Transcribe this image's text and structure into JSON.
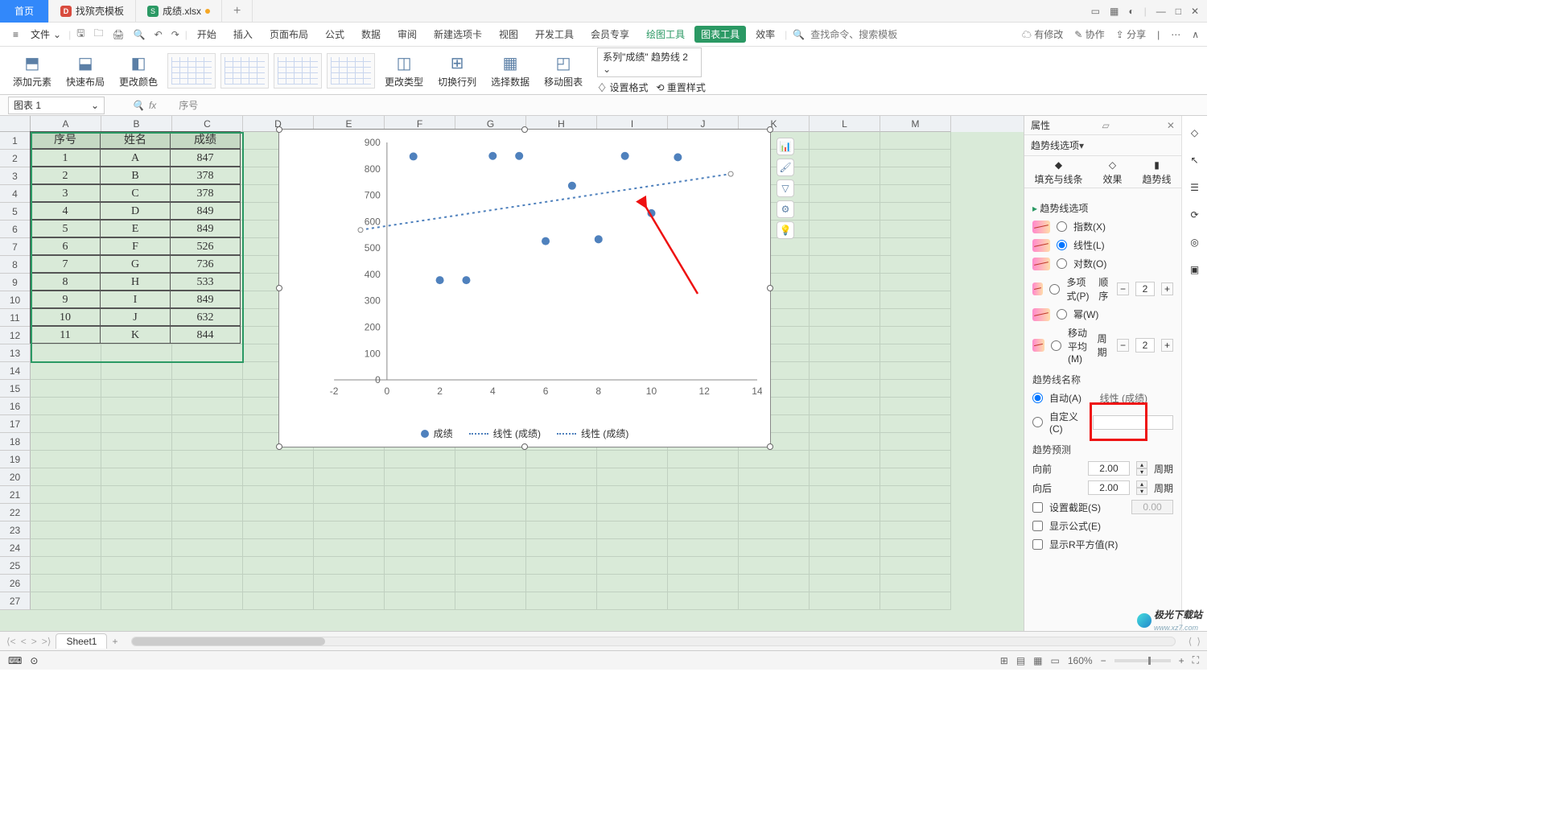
{
  "title_tabs": {
    "home": "首页",
    "t1": "找殡壳模板",
    "t2": "成绩.xlsx"
  },
  "menu": {
    "file": "文件",
    "tabs": [
      "开始",
      "插入",
      "页面布局",
      "公式",
      "数据",
      "审阅",
      "新建选项卡",
      "视图",
      "开发工具",
      "会员专享"
    ],
    "draw": "绘图工具",
    "chart": "图表工具",
    "eff": "效率",
    "search_ph": "查找命令、搜索模板",
    "right": [
      "有修改",
      "协作",
      "分享"
    ]
  },
  "ribbon": {
    "b1": "添加元素",
    "b2": "快速布局",
    "b3": "更改颜色",
    "b4": "更改类型",
    "b5": "切换行列",
    "b6": "选择数据",
    "b7": "移动图表",
    "sel": "系列\"成绩\" 趋势线 2",
    "l1": "设置格式",
    "l2": "重置样式"
  },
  "namebox": "图表 1",
  "fxtext": "序号",
  "cols": [
    "A",
    "B",
    "C",
    "D",
    "E",
    "F",
    "G",
    "H",
    "I",
    "J",
    "K",
    "L",
    "M"
  ],
  "rows": 27,
  "table": {
    "head": [
      "序号",
      "姓名",
      "成绩"
    ],
    "body": [
      [
        "1",
        "A",
        "847"
      ],
      [
        "2",
        "B",
        "378"
      ],
      [
        "3",
        "C",
        "378"
      ],
      [
        "4",
        "D",
        "849"
      ],
      [
        "5",
        "E",
        "849"
      ],
      [
        "6",
        "F",
        "526"
      ],
      [
        "7",
        "G",
        "736"
      ],
      [
        "8",
        "H",
        "533"
      ],
      [
        "9",
        "I",
        "849"
      ],
      [
        "10",
        "J",
        "632"
      ],
      [
        "11",
        "K",
        "844"
      ]
    ]
  },
  "chart_data": {
    "type": "scatter",
    "series": [
      {
        "name": "成绩",
        "x": [
          1,
          2,
          3,
          4,
          5,
          6,
          7,
          8,
          9,
          10,
          11
        ],
        "y": [
          847,
          378,
          378,
          849,
          849,
          526,
          736,
          533,
          849,
          632,
          844
        ]
      }
    ],
    "trendlines": [
      {
        "name": "线性 (成绩)",
        "type": "linear"
      },
      {
        "name": "线性 (成绩)",
        "type": "linear"
      }
    ],
    "xlim": [
      -2,
      14
    ],
    "ylim": [
      0,
      900
    ],
    "yticks": [
      0,
      100,
      200,
      300,
      400,
      500,
      600,
      700,
      800,
      900
    ],
    "xticks": [
      -2,
      0,
      2,
      4,
      6,
      8,
      10,
      12,
      14
    ],
    "legend": [
      "成绩",
      "线性 (成绩)",
      "线性 (成绩)"
    ]
  },
  "panel": {
    "title": "属性",
    "dropdown": "趋势线选项",
    "tabs": [
      "填充与线条",
      "效果",
      "趋势线"
    ],
    "sect": "趋势线选项",
    "opts": {
      "exp": "指数(X)",
      "lin": "线性(L)",
      "log": "对数(O)",
      "poly": "多项式(P)",
      "pow": "幂(W)",
      "ma": "移动\n平均(M)"
    },
    "poly_lbl": "顺序",
    "poly_v": "2",
    "ma_lbl": "周期",
    "ma_v": "2",
    "name_sect": "趋势线名称",
    "auto": "自动(A)",
    "auto_v": "线性 (成绩)",
    "custom": "自定义(C)",
    "fc_sect": "趋势预测",
    "fwd": "向前",
    "fwd_v": "2.00",
    "fwd_u": "周期",
    "bwd": "向后",
    "bwd_v": "2.00",
    "bwd_u": "周期",
    "intercept": "设置截距(S)",
    "int_v": "0.00",
    "showeq": "显示公式(E)",
    "showr2": "显示R平方值(R)"
  },
  "sheet_tab": "Sheet1",
  "zoom": "160%",
  "watermark": "极光下载站",
  "watermark_sub": "www.xz7.com"
}
